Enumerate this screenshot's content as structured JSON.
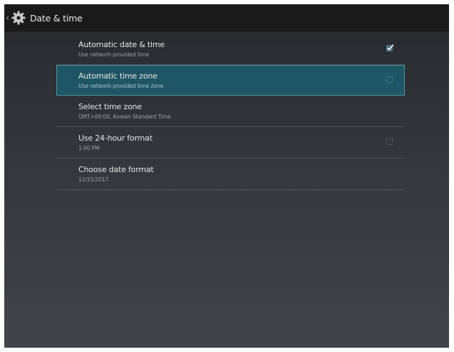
{
  "header": {
    "back_icon": "chevron-left-icon",
    "app_icon": "gear-icon",
    "title": "Date & time"
  },
  "settings": [
    {
      "title": "Automatic date & time",
      "subtitle": "Use network-provided time",
      "control": "checkbox",
      "checked": true,
      "focused": false
    },
    {
      "title": "Automatic time zone",
      "subtitle": "Use network-provided time zone",
      "control": "checkbox",
      "checked": false,
      "focused": true
    },
    {
      "title": "Select time zone",
      "subtitle": "GMT+09:00, Korean Standard Time",
      "control": "none",
      "focused": false
    },
    {
      "title": "Use 24-hour format",
      "subtitle": "1:00 PM",
      "control": "checkbox",
      "checked": false,
      "focused": false
    },
    {
      "title": "Choose date format",
      "subtitle": "12/31/2017",
      "control": "none",
      "focused": false
    }
  ],
  "colors": {
    "focus_background": "#1f5665",
    "checkbox_checked": "#4f6f7f"
  }
}
